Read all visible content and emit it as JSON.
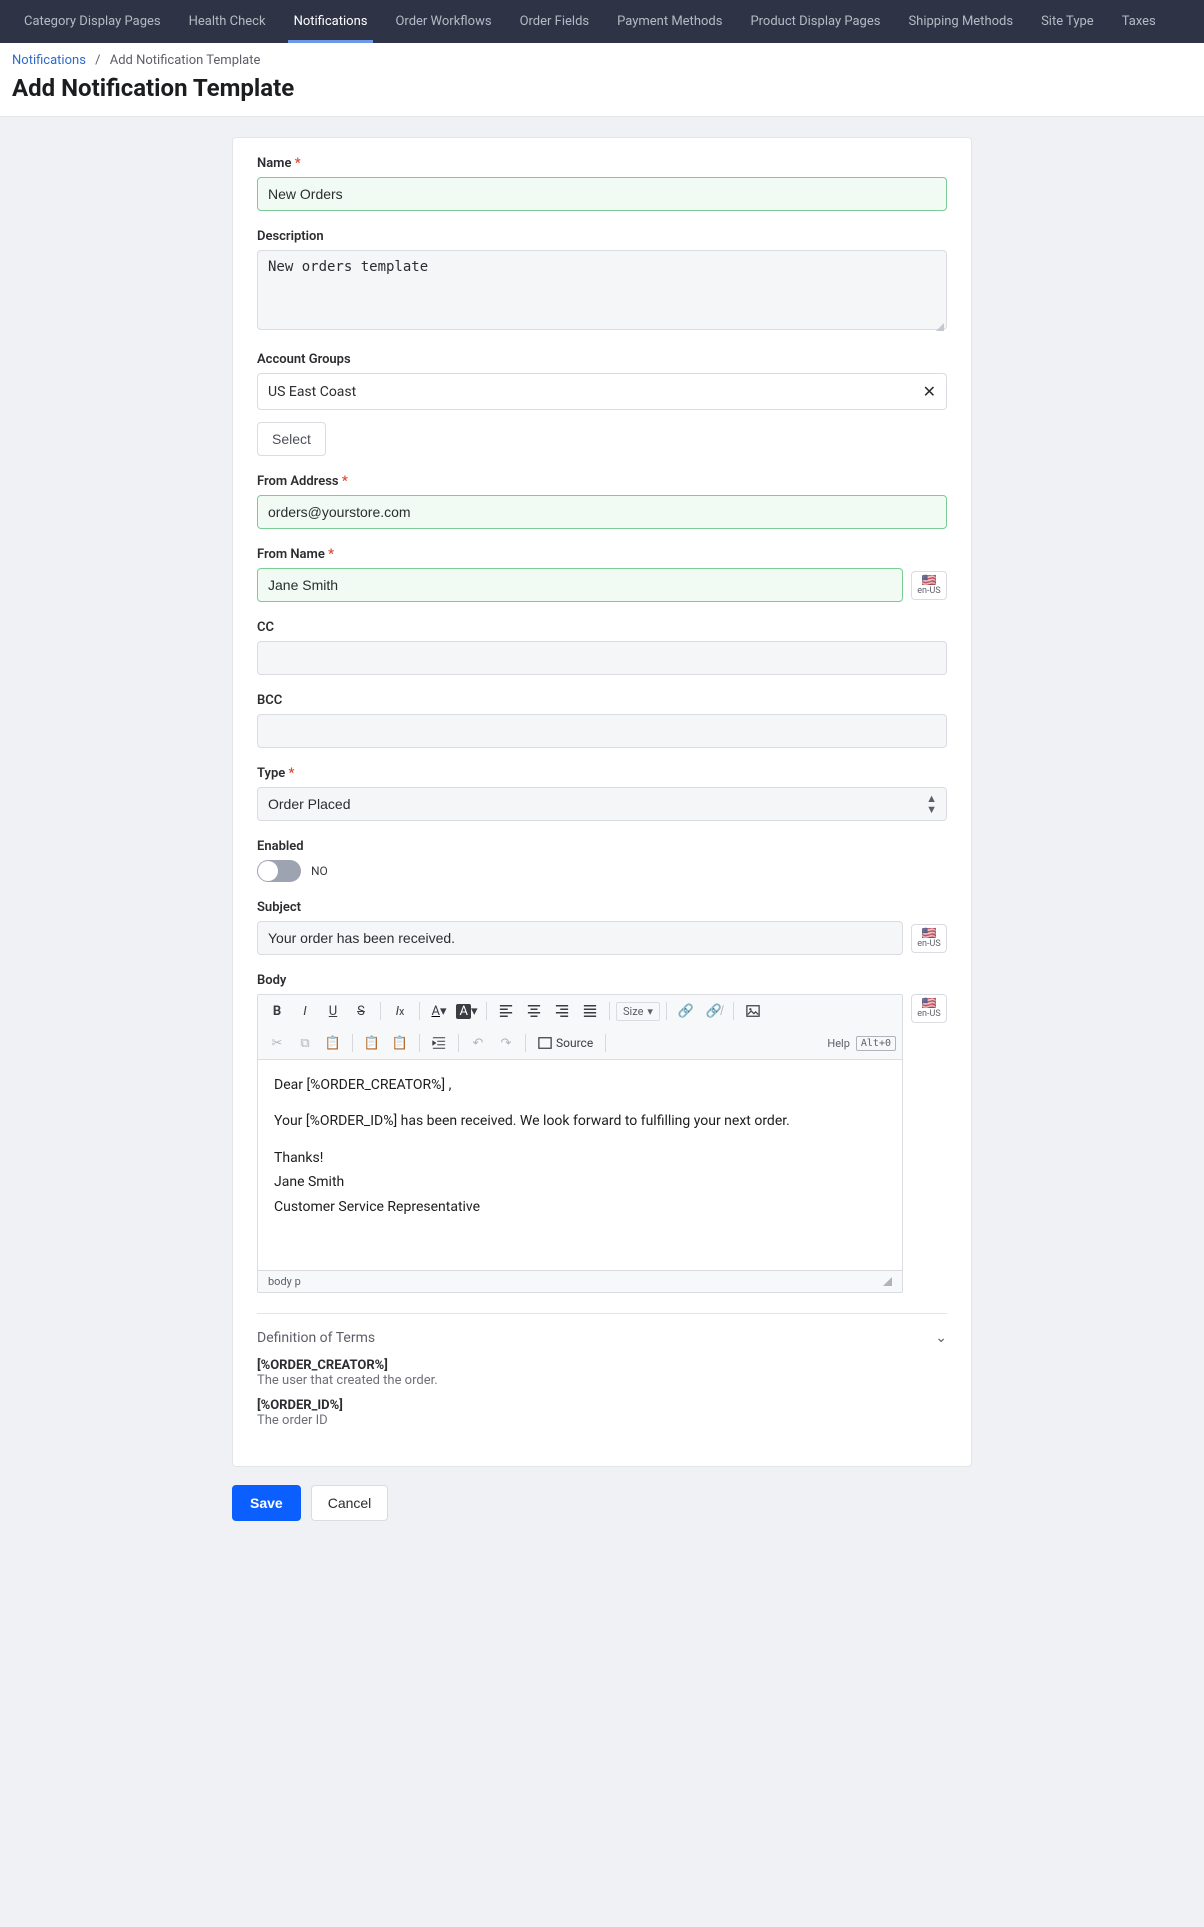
{
  "nav": {
    "items": [
      {
        "label": "Category Display Pages",
        "active": false
      },
      {
        "label": "Health Check",
        "active": false
      },
      {
        "label": "Notifications",
        "active": true
      },
      {
        "label": "Order Workflows",
        "active": false
      },
      {
        "label": "Order Fields",
        "active": false
      },
      {
        "label": "Payment Methods",
        "active": false
      },
      {
        "label": "Product Display Pages",
        "active": false
      },
      {
        "label": "Shipping Methods",
        "active": false
      },
      {
        "label": "Site Type",
        "active": false
      },
      {
        "label": "Taxes",
        "active": false
      }
    ]
  },
  "breadcrumb": {
    "root": "Notifications",
    "current": "Add Notification Template"
  },
  "page_title": "Add Notification Template",
  "form": {
    "name": {
      "label": "Name",
      "value": "New Orders"
    },
    "description": {
      "label": "Description",
      "value": "New orders template"
    },
    "account_groups": {
      "label": "Account Groups",
      "values": [
        "US East Coast"
      ],
      "select_button": "Select"
    },
    "from_address": {
      "label": "From Address",
      "value": "orders@yourstore.com"
    },
    "from_name": {
      "label": "From Name",
      "value": "Jane Smith"
    },
    "cc": {
      "label": "CC",
      "value": ""
    },
    "bcc": {
      "label": "BCC",
      "value": ""
    },
    "type": {
      "label": "Type",
      "value": "Order Placed"
    },
    "enabled": {
      "label": "Enabled",
      "state_text": "NO",
      "on": false
    },
    "subject": {
      "label": "Subject",
      "value": "Your order has been received."
    },
    "body": {
      "label": "Body",
      "lines": {
        "l1": "Dear [%ORDER_CREATOR%] ,",
        "l2": "Your [%ORDER_ID%] has been received. We look forward to fulfilling your next order.",
        "l3": "Thanks!",
        "l4": "Jane Smith",
        "l5": "Customer Service Representative"
      },
      "path": "body   p"
    },
    "editor_toolbar": {
      "size_label": "Size",
      "source_label": "Source",
      "help_label": "Help",
      "help_key": "Alt+0"
    },
    "locale": {
      "flag": "🇺🇸",
      "code": "en-US"
    }
  },
  "definitions": {
    "title": "Definition of Terms",
    "terms": [
      {
        "token": "[%ORDER_CREATOR%]",
        "desc": "The user that created the order."
      },
      {
        "token": "[%ORDER_ID%]",
        "desc": "The order ID"
      }
    ]
  },
  "actions": {
    "save": "Save",
    "cancel": "Cancel"
  }
}
